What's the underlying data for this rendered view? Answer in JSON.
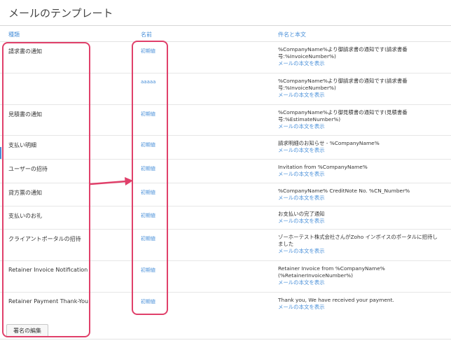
{
  "page": {
    "title": "メールのテンプレート"
  },
  "table": {
    "headers": {
      "type": "種類",
      "name": "名前",
      "body": "件名と本文"
    },
    "rows": [
      {
        "type": "請求書の通知",
        "name": "初期値",
        "subject": "%CompanyName%より御請求書の通知です(請求書番号:%InvoiceNumber%)",
        "link": "メールの本文を表示"
      },
      {
        "type": "",
        "name": "aaaaa",
        "subject": "%CompanyName%より御請求書の通知です(請求書番号:%InvoiceNumber%)",
        "link": "メールの本文を表示"
      },
      {
        "type": "見積書の通知",
        "name": "初期値",
        "subject": "%CompanyName%より御見積書の通知です(見積書番号:%EstimateNumber%)",
        "link": "メールの本文を表示"
      },
      {
        "type": "支払い明細",
        "name": "初期値",
        "subject": "請求明細のお知らせ - %CompanyName%",
        "link": "メールの本文を表示"
      },
      {
        "type": "ユーザーの招待",
        "name": "初期値",
        "subject": "Invitation from %CompanyName%",
        "link": "メールの本文を表示"
      },
      {
        "type": "貸方票の通知",
        "name": "初期値",
        "subject": "%CompanyName% CreditNote No. %CN_Number%",
        "link": "メールの本文を表示"
      },
      {
        "type": "支払いのお礼",
        "name": "初期値",
        "subject": "お支払いの完了通知",
        "link": "メールの本文を表示"
      },
      {
        "type": "クライアントポータルの招待",
        "name": "初期値",
        "subject": "ゾーホーテスト株式会社さんがZoho インボイスのポータルに招待しました",
        "link": "メールの本文を表示"
      },
      {
        "type": "Retainer Invoice Notification",
        "name": "初期値",
        "subject": "Retainer Invoice from %CompanyName% (%RetainerInvoiceNumber%)",
        "link": "メールの本文を表示"
      },
      {
        "type": "Retainer Payment Thank-You",
        "name": "初期値",
        "subject": "Thank you, We have received your payment.",
        "link": "メールの本文を表示"
      }
    ]
  },
  "footer": {
    "signature_button": "署名の編集"
  },
  "colors": {
    "link": "#4a90d9",
    "highlight": "#e0406a"
  }
}
